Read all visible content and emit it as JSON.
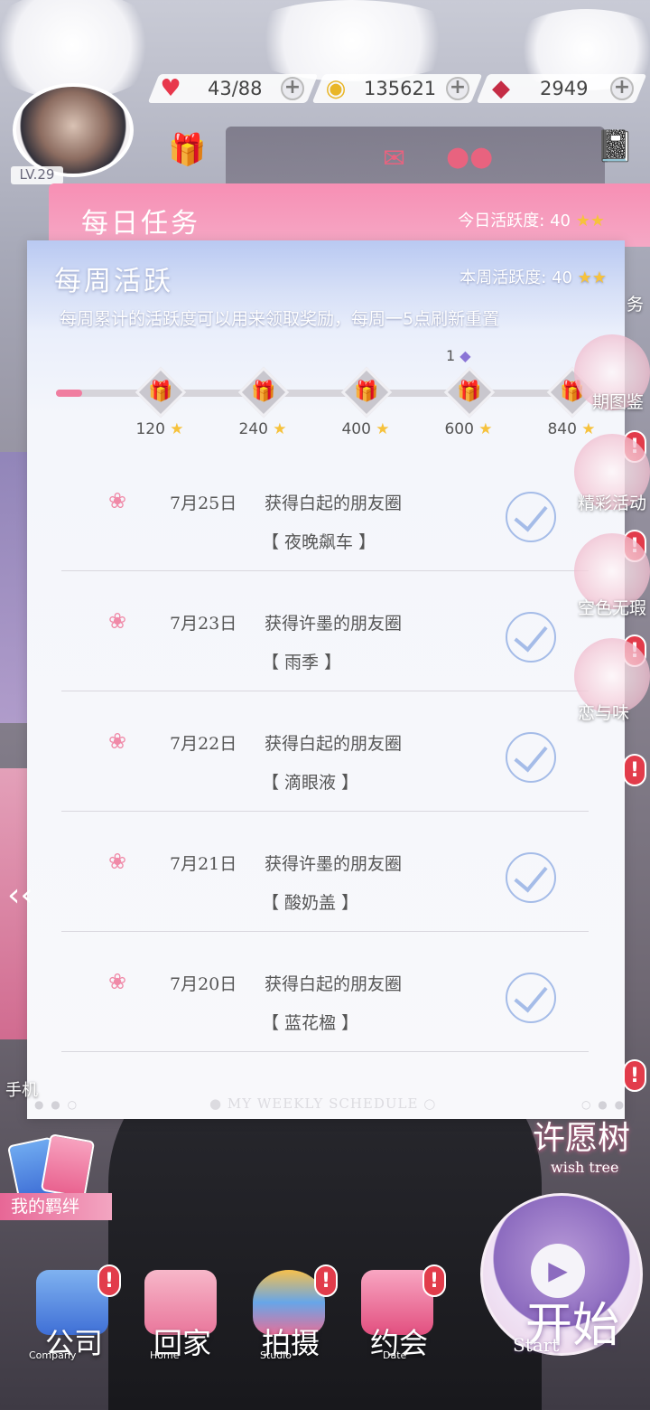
{
  "resources": {
    "stamina": "43/88",
    "gold": "135621",
    "diamonds": "2949"
  },
  "player": {
    "level": "LV.29"
  },
  "daily": {
    "title": "每日任务",
    "points_label": "今日活跃度: 40"
  },
  "weekly": {
    "title": "每周活跃",
    "points_label": "本周活跃度: 40",
    "description": "每周累计的活跃度可以用来领取奖励，每周一5点刷新重置",
    "progress": {
      "current": 40,
      "max": 840
    },
    "gem_count": "1",
    "milestones": [
      {
        "value": "120"
      },
      {
        "value": "240"
      },
      {
        "value": "400"
      },
      {
        "value": "600"
      },
      {
        "value": "840"
      }
    ],
    "tasks": [
      {
        "date": "7月25日",
        "title": "获得白起的朋友圈",
        "subtitle": "【 夜晚飙车 】",
        "completed": true
      },
      {
        "date": "7月23日",
        "title": "获得许墨的朋友圈",
        "subtitle": "【 雨季 】",
        "completed": true
      },
      {
        "date": "7月22日",
        "title": "获得白起的朋友圈",
        "subtitle": "【 滴眼液 】",
        "completed": true
      },
      {
        "date": "7月21日",
        "title": "获得许墨的朋友圈",
        "subtitle": "【 酸奶盖 】",
        "completed": true
      },
      {
        "date": "7月20日",
        "title": "获得白起的朋友圈",
        "subtitle": "【 蓝花楹 】",
        "completed": true
      }
    ],
    "footer": "MY WEEKLY SCHEDULE"
  },
  "side": {
    "label_1": "务",
    "label_2": "期图鉴",
    "label_3": "精彩活动",
    "label_4": "空色无瑕",
    "label_5": "恋与味",
    "left_label": "手机",
    "alert": "!"
  },
  "wish_tree": {
    "title": "许愿树",
    "subtitle": "wish tree"
  },
  "bond": {
    "label": "我的羁绊"
  },
  "nav": [
    {
      "label": "公司",
      "en": "Company"
    },
    {
      "label": "回家",
      "en": "Home"
    },
    {
      "label": "拍摄",
      "en": "Studio"
    },
    {
      "label": "约会",
      "en": "Date"
    }
  ],
  "start": {
    "label": "开始",
    "en": "Start"
  },
  "colors": {
    "accent_pink": "#f78fb4",
    "check_blue": "#a5bce8",
    "alert_red": "#e23c4b",
    "progress_fill": "#f07da0"
  }
}
